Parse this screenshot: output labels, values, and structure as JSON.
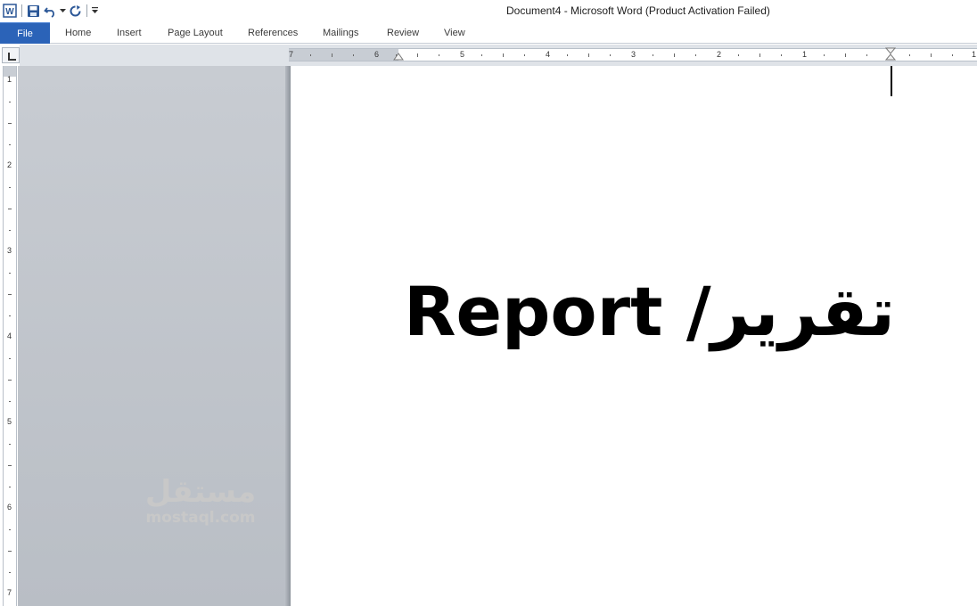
{
  "window": {
    "title": "Document4  -  Microsoft Word (Product Activation Failed)"
  },
  "quick_access": {
    "icons": [
      "word-icon",
      "save-icon",
      "undo-icon",
      "undo-dropdown-icon",
      "redo-icon",
      "customize-qat-icon"
    ]
  },
  "ribbon": {
    "tabs": [
      {
        "label": "File"
      },
      {
        "label": "Home"
      },
      {
        "label": "Insert"
      },
      {
        "label": "Page Layout"
      },
      {
        "label": "References"
      },
      {
        "label": "Mailings"
      },
      {
        "label": "Review"
      },
      {
        "label": "View"
      }
    ]
  },
  "rulers": {
    "horizontal_labels": [
      "7",
      "6",
      "5",
      "4",
      "3",
      "2",
      "1",
      "1"
    ],
    "vertical_labels": [
      "1",
      "2",
      "3",
      "4",
      "5",
      "6",
      "7"
    ]
  },
  "document": {
    "text": "تقرير/ Report"
  },
  "watermark": {
    "arabic": "مستقل",
    "latin": "mostaql.com"
  },
  "colors": {
    "file_tab": "#2b63b8",
    "canvas": "#c8ccd2",
    "watermark": "#c8c8c8"
  }
}
